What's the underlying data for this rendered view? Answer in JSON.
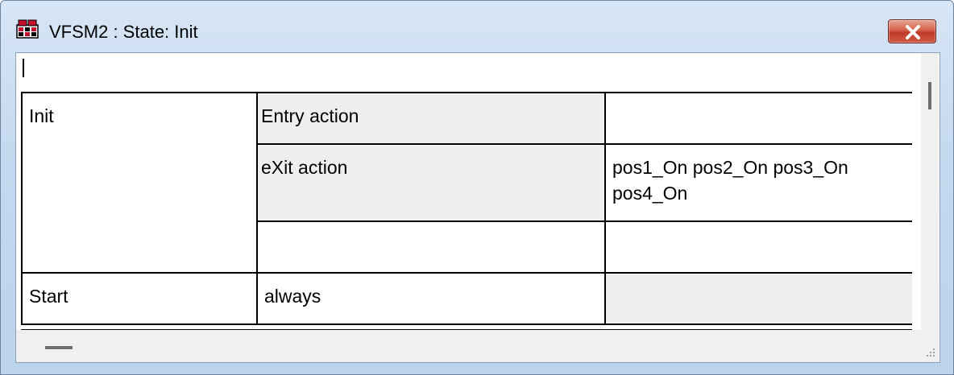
{
  "window": {
    "title": "VFSM2 : State: Init"
  },
  "icons": {
    "app": "vfsm-app-icon",
    "close": "close-icon",
    "grip": "resize-grip-icon"
  },
  "colors": {
    "titlebar": "#c5d9ef",
    "close_button": "#c0392b",
    "cell_gray": "#efefef"
  },
  "table": {
    "state_name": "Init",
    "rows": [
      {
        "label": "Entry action",
        "value": ""
      },
      {
        "label": "eXit action",
        "value": "pos1_On pos2_On pos3_On pos4_On"
      },
      {
        "label": "",
        "value": ""
      }
    ],
    "transition": {
      "target": "Start",
      "condition": "always",
      "action": ""
    }
  }
}
